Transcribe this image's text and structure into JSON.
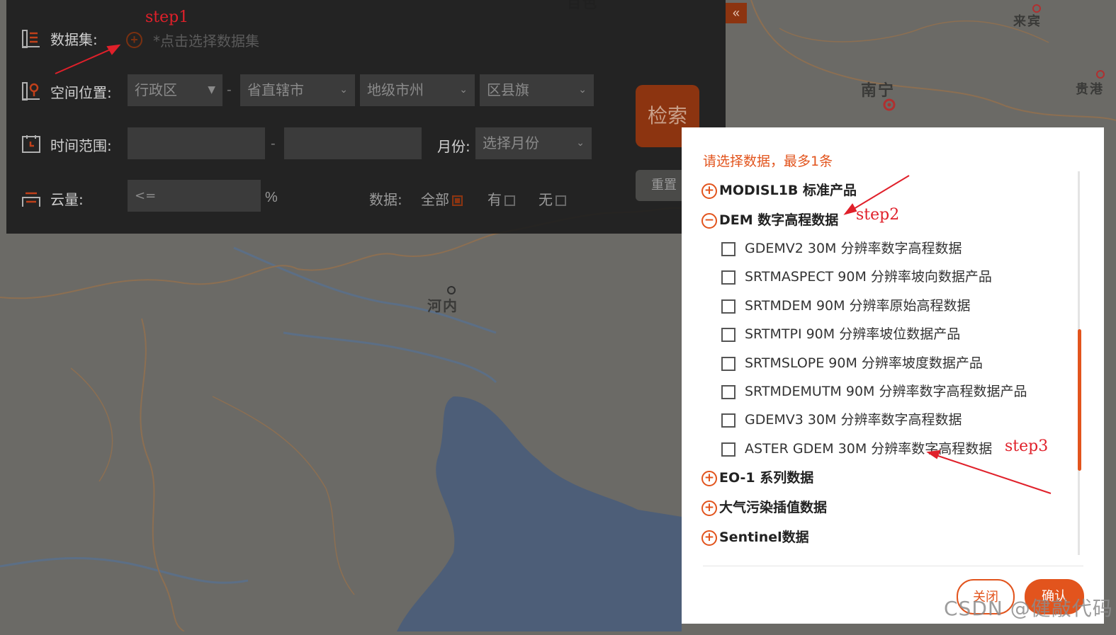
{
  "map": {
    "city_labels": [
      "南宁",
      "来宾",
      "贵港",
      "河内",
      "百色"
    ],
    "water_color": "#4d5e78",
    "land_color": "#6b6a66"
  },
  "search_panel": {
    "dataset_label": "数据集:",
    "dataset_placeholder": "*点击选择数据集",
    "location_label": "空间位置:",
    "admin_select": "行政区",
    "province_select": "省直辖市",
    "city_select": "地级市州",
    "county_select": "区县旗",
    "time_label": "时间范围:",
    "time_separator": "-",
    "region_separator": "-",
    "month_label": "月份:",
    "month_select": "选择月份",
    "cloud_label": "云量:",
    "cloud_input": "<=",
    "cloud_unit": "%",
    "data_label": "数据:",
    "data_options": [
      "全部",
      "有",
      "无"
    ],
    "search_button": "检索",
    "reset_button": "重置",
    "collapse_icon": "«"
  },
  "dialog": {
    "hint": "请选择数据，最多1条",
    "groups": [
      {
        "name": "MODISL1B 标准产品",
        "expanded": false
      },
      {
        "name": "DEM 数字高程数据",
        "expanded": true
      },
      {
        "name": "EO-1 系列数据",
        "expanded": false
      },
      {
        "name": "大气污染插值数据",
        "expanded": false
      },
      {
        "name": "Sentinel数据",
        "expanded": false
      }
    ],
    "items": [
      "GDEMV2 30M 分辨率数字高程数据",
      "SRTMASPECT 90M 分辨率坡向数据产品",
      "SRTMDEM 90M 分辨率原始高程数据",
      "SRTMTPI 90M 分辨率坡位数据产品",
      "SRTMSLOPE 90M 分辨率坡度数据产品",
      "SRTMDEMUTM 90M 分辨率数字高程数据产品",
      "GDEMV3 30M 分辨率数字高程数据",
      "ASTER GDEM 30M 分辨率数字高程数据"
    ],
    "close_button": "关闭",
    "confirm_button": "确认"
  },
  "annotations": {
    "step1": "step1",
    "step2": "step2",
    "step3": "step3"
  },
  "watermark": "CSDN @健敲代码",
  "colors": {
    "accent": "#e2541d",
    "annotation": "#e0202a",
    "panel_bg": "#1e1e1e"
  }
}
